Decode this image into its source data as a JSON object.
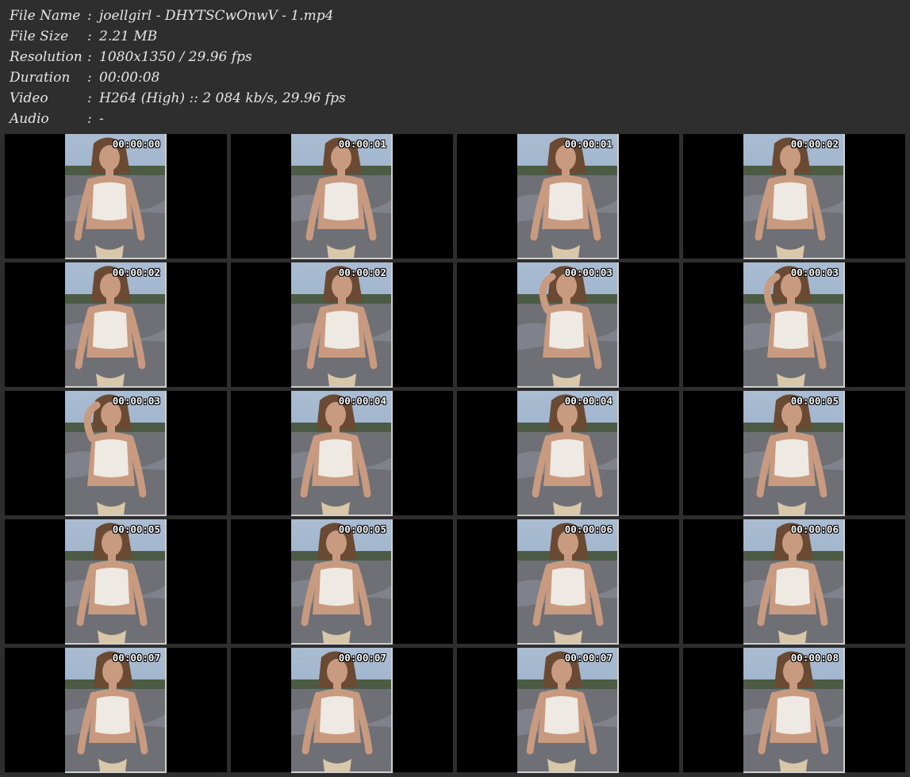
{
  "info": [
    {
      "label": "File Name",
      "value": "joellgirl - DHYTSCwOnwV - 1.mp4"
    },
    {
      "label": "File Size",
      "value": "2.21 MB"
    },
    {
      "label": "Resolution",
      "value": "1080x1350 / 29.96 fps"
    },
    {
      "label": "Duration",
      "value": "00:00:08"
    },
    {
      "label": "Video",
      "value": "H264 (High) :: 2 084 kb/s, 29.96 fps"
    },
    {
      "label": "Audio",
      "value": "-"
    }
  ],
  "separator": ":",
  "thumbnails": [
    {
      "timestamp": "00:00:00"
    },
    {
      "timestamp": "00:00:01"
    },
    {
      "timestamp": "00:00:01"
    },
    {
      "timestamp": "00:00:02"
    },
    {
      "timestamp": "00:00:02"
    },
    {
      "timestamp": "00:00:02"
    },
    {
      "timestamp": "00:00:03"
    },
    {
      "timestamp": "00:00:03"
    },
    {
      "timestamp": "00:00:03"
    },
    {
      "timestamp": "00:00:04"
    },
    {
      "timestamp": "00:00:04"
    },
    {
      "timestamp": "00:00:05"
    },
    {
      "timestamp": "00:00:05"
    },
    {
      "timestamp": "00:00:05"
    },
    {
      "timestamp": "00:00:06"
    },
    {
      "timestamp": "00:00:06"
    },
    {
      "timestamp": "00:00:07"
    },
    {
      "timestamp": "00:00:07"
    },
    {
      "timestamp": "00:00:07"
    },
    {
      "timestamp": "00:00:08"
    }
  ],
  "colors": {
    "background": "#2e2e2e",
    "text": "#e6e6e6",
    "cell": "#000000",
    "frame_border": "#cfcfcf",
    "sky": "#8fa6c0",
    "sand": "#6f6f76",
    "skin": "#c89a80",
    "top": "#efe9e4",
    "hair": "#6b4a33"
  }
}
